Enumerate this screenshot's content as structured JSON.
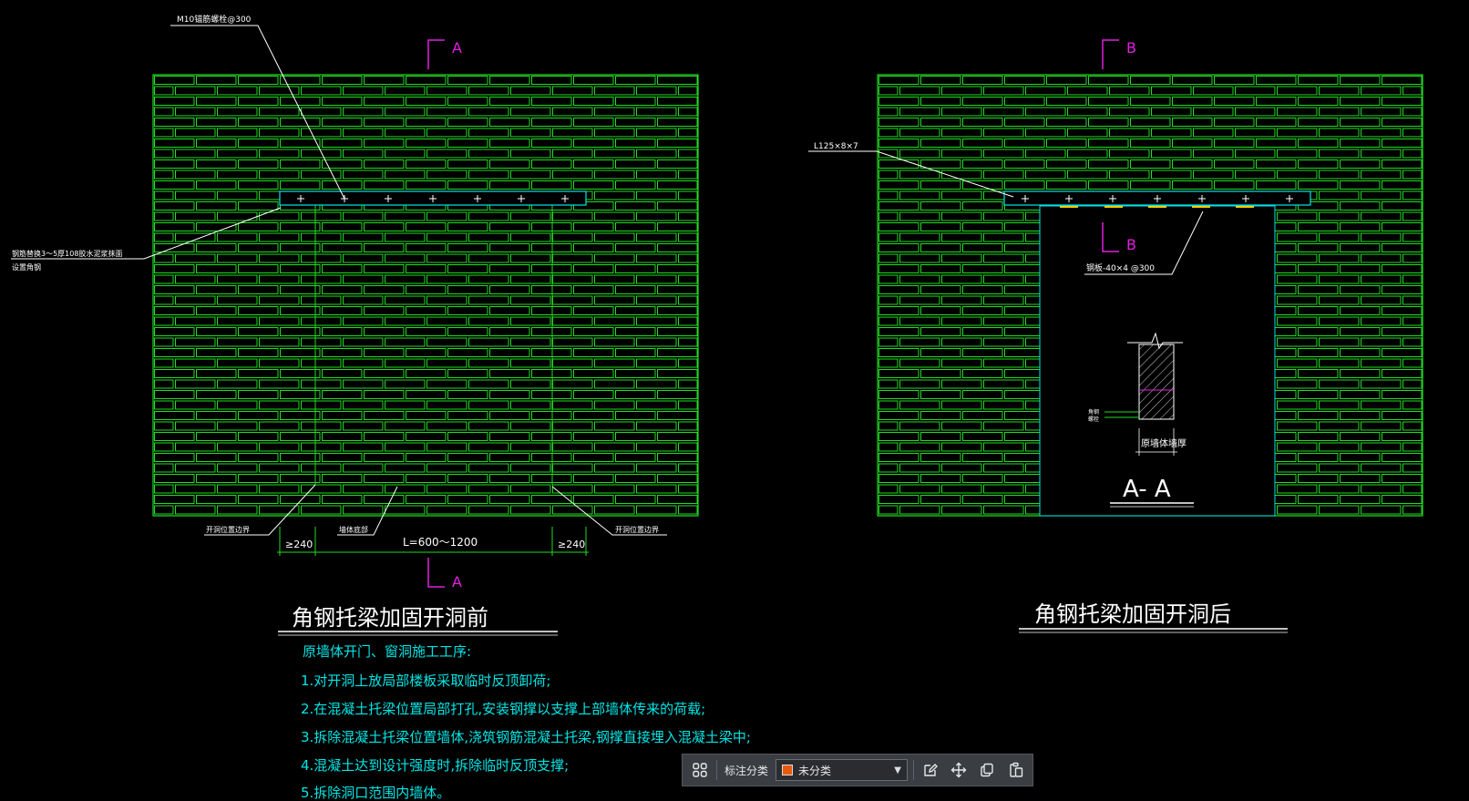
{
  "colors": {
    "background": "#000000",
    "brick": "#22dd22",
    "cyan": "#00e5e5",
    "magenta": "#e020e0",
    "white": "#ffffff",
    "yellow": "#ffcc00",
    "category": "#e8590c"
  },
  "left": {
    "section_top": "A",
    "section_bottom": "A",
    "label_bolt": "M10锚筋螺栓@300",
    "label_side_1": "钢筋替换3～5厚108胶水泥浆抹面",
    "label_side_2": "设置角钢",
    "label_bottom_left": "开洞位置边界",
    "label_bottom_mid": "墙体底部",
    "label_bottom_right": "开洞位置边界",
    "dim_left": "≥240",
    "dim_mid": "L=600～1200",
    "dim_right": "≥240",
    "title": "角钢托梁加固开洞前"
  },
  "right": {
    "section_top": "B",
    "section_mid": "B",
    "label_angle": "L125×8×7",
    "label_plate": "钢板-40×4 @300",
    "label_side_a": "角钢",
    "label_side_b": "螺栓",
    "label_wall": "原墙体墙厚",
    "section_title": "A- A",
    "title": "角钢托梁加固开洞后"
  },
  "notes": {
    "heading": "原墙体开门、窗洞施工工序:",
    "items": [
      "1.对开洞上放局部楼板采取临时反顶卸荷;",
      "2.在混凝土托梁位置局部打孔,安装钢撑以支撑上部墙体传来的荷载;",
      "3.拆除混凝土托梁位置墙体,浇筑钢筋混凝土托梁,钢撑直接埋入混凝土梁中;",
      "4.混凝土达到设计强度时,拆除临时反顶支撑;",
      "5.拆除洞口范围内墙体。"
    ]
  },
  "toolbar": {
    "label": "标注分类",
    "selected": "未分类"
  }
}
